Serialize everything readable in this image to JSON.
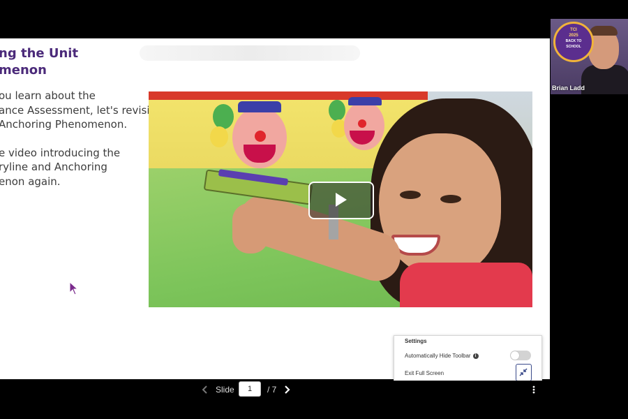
{
  "slide": {
    "title_lines": [
      "ng the Unit",
      "menon"
    ],
    "paragraph1_lines": [
      "ou learn about the",
      "ance Assessment, let's revisit",
      "Anchoring Phenomenon."
    ],
    "paragraph2_lines": [
      "e video introducing the",
      "ryline and Anchoring",
      "enon again."
    ]
  },
  "video": {
    "play_icon": "play-icon"
  },
  "presenter": {
    "name": "Brian Ladd",
    "badge": {
      "logo": "TCI",
      "year": "2025",
      "subtitle_line1": "BACK TO",
      "subtitle_line2": "SCHOOL"
    }
  },
  "settings": {
    "title": "Settings",
    "auto_hide_label": "Automatically Hide Toolbar",
    "auto_hide_enabled": false,
    "exit_fullscreen_label": "Exit Full Screen",
    "info_icon": "info-icon",
    "exit_icon": "exit-fullscreen-icon"
  },
  "toolbar": {
    "slide_label": "Slide",
    "current_slide": "1",
    "total": "/ 7",
    "prev_icon": "chevron-left-icon",
    "next_icon": "chevron-right-icon",
    "more_icon": "more-vertical-icon"
  },
  "colors": {
    "title": "#4b2a7a",
    "body_text": "#3c3c3c",
    "toolbar_bg": "#000000",
    "accent_border": "#3a4a8a",
    "cursor": "#7a2a8c"
  }
}
